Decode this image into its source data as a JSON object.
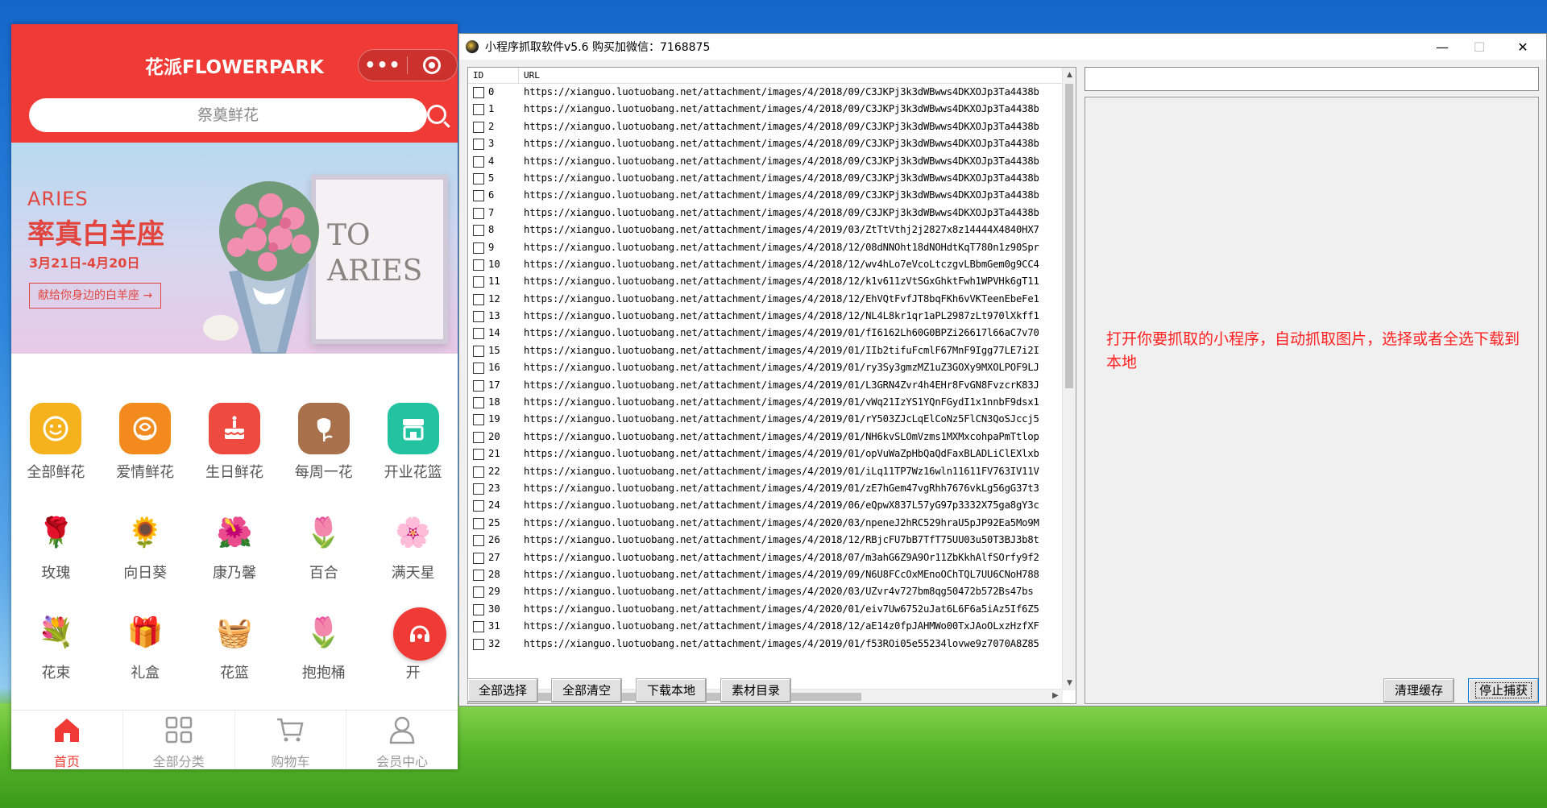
{
  "phone": {
    "title": "花派FLOWERPARK",
    "capsule_more": "•••",
    "search_placeholder": "祭奠鲜花",
    "banner": {
      "aries_en": "ARIES",
      "title": "率真白羊座",
      "date": "3月21日-4月20日",
      "button": "献给你身边的白羊座 →",
      "frame_text_1": "TO",
      "frame_text_2": "ARIES"
    },
    "categories_main": [
      {
        "label": "全部鲜花",
        "icon": "smile-flower-icon",
        "color": "#f6b21c"
      },
      {
        "label": "爱情鲜花",
        "icon": "rose-icon",
        "color": "#f28a1e"
      },
      {
        "label": "生日鲜花",
        "icon": "cake-icon",
        "color": "#ef4a3f"
      },
      {
        "label": "每周一花",
        "icon": "flower-bud-icon",
        "color": "#a8714c"
      },
      {
        "label": "开业花篮",
        "icon": "shop-icon",
        "color": "#23c2a0"
      }
    ],
    "categories_flowers": [
      {
        "label": "玫瑰",
        "glyph": "🌹"
      },
      {
        "label": "向日葵",
        "glyph": "🌻"
      },
      {
        "label": "康乃馨",
        "glyph": "🌺"
      },
      {
        "label": "百合",
        "glyph": "🌷"
      },
      {
        "label": "满天星",
        "glyph": "🌸"
      }
    ],
    "categories_gifts": [
      {
        "label": "花束",
        "glyph": "💐"
      },
      {
        "label": "礼盒",
        "glyph": "🎁"
      },
      {
        "label": "花篮",
        "glyph": "🧺"
      },
      {
        "label": "抱抱桶",
        "glyph": "🌷"
      },
      {
        "label": "开",
        "glyph": "🌱"
      }
    ],
    "tabs": [
      {
        "label": "首页",
        "icon": "home-icon",
        "active": true
      },
      {
        "label": "全部分类",
        "icon": "grid-icon",
        "active": false
      },
      {
        "label": "购物车",
        "icon": "cart-icon",
        "active": false
      },
      {
        "label": "会员中心",
        "icon": "user-icon",
        "active": false
      }
    ],
    "accent": "#f03a35"
  },
  "window": {
    "title": "小程序抓取软件v5.6 购买加微信：7168875",
    "min": "—",
    "max": "☐",
    "close": "✕",
    "columns": {
      "id": "ID",
      "url": "URL"
    },
    "rows": [
      {
        "id": "0",
        "url": "https://xianguo.luotuobang.net/attachment/images/4/2018/09/C3JKPj3k3dWBwws4DKXOJp3Ta4438b"
      },
      {
        "id": "1",
        "url": "https://xianguo.luotuobang.net/attachment/images/4/2018/09/C3JKPj3k3dWBwws4DKXOJp3Ta4438b"
      },
      {
        "id": "2",
        "url": "https://xianguo.luotuobang.net/attachment/images/4/2018/09/C3JKPj3k3dWBwws4DKXOJp3Ta4438b"
      },
      {
        "id": "3",
        "url": "https://xianguo.luotuobang.net/attachment/images/4/2018/09/C3JKPj3k3dWBwws4DKXOJp3Ta4438b"
      },
      {
        "id": "4",
        "url": "https://xianguo.luotuobang.net/attachment/images/4/2018/09/C3JKPj3k3dWBwws4DKXOJp3Ta4438b"
      },
      {
        "id": "5",
        "url": "https://xianguo.luotuobang.net/attachment/images/4/2018/09/C3JKPj3k3dWBwws4DKXOJp3Ta4438b"
      },
      {
        "id": "6",
        "url": "https://xianguo.luotuobang.net/attachment/images/4/2018/09/C3JKPj3k3dWBwws4DKXOJp3Ta4438b"
      },
      {
        "id": "7",
        "url": "https://xianguo.luotuobang.net/attachment/images/4/2018/09/C3JKPj3k3dWBwws4DKXOJp3Ta4438b"
      },
      {
        "id": "8",
        "url": "https://xianguo.luotuobang.net/attachment/images/4/2019/03/ZtTtVthj2j2827x8z14444X4840HX7"
      },
      {
        "id": "9",
        "url": "https://xianguo.luotuobang.net/attachment/images/4/2018/12/08dNNOht18dNOHdtKqT780n1z90Spr"
      },
      {
        "id": "10",
        "url": "https://xianguo.luotuobang.net/attachment/images/4/2018/12/wv4hLo7eVcoLtczgvLBbmGem0g9CC4"
      },
      {
        "id": "11",
        "url": "https://xianguo.luotuobang.net/attachment/images/4/2018/12/k1v611zVtSGxGhktFwh1WPVHk6gT11"
      },
      {
        "id": "12",
        "url": "https://xianguo.luotuobang.net/attachment/images/4/2018/12/EhVQtFvfJT8bqFKh6vVKTeenEbeFe1"
      },
      {
        "id": "13",
        "url": "https://xianguo.luotuobang.net/attachment/images/4/2018/12/NL4L8kr1qr1aPL2987zLt970lXkff1"
      },
      {
        "id": "14",
        "url": "https://xianguo.luotuobang.net/attachment/images/4/2019/01/fI6162Lh60G0BPZi26617l66aC7v70"
      },
      {
        "id": "15",
        "url": "https://xianguo.luotuobang.net/attachment/images/4/2019/01/IIb2tifuFcmlF67MnF9Igg77LE7i2I"
      },
      {
        "id": "16",
        "url": "https://xianguo.luotuobang.net/attachment/images/4/2019/01/ry3Sy3gmzMZ1uZ3GOXy9MXOLPOF9LJ"
      },
      {
        "id": "17",
        "url": "https://xianguo.luotuobang.net/attachment/images/4/2019/01/L3GRN4Zvr4h4EHr8FvGN8FvzcrK83J"
      },
      {
        "id": "18",
        "url": "https://xianguo.luotuobang.net/attachment/images/4/2019/01/vWq21IzYS1YQnFGydI1x1nnbF9dsx1"
      },
      {
        "id": "19",
        "url": "https://xianguo.luotuobang.net/attachment/images/4/2019/01/rY503ZJcLqElCoNz5FlCN3QoSJccj5"
      },
      {
        "id": "20",
        "url": "https://xianguo.luotuobang.net/attachment/images/4/2019/01/NH6kvSLOmVzms1MXMxcohpaPmTtlop"
      },
      {
        "id": "21",
        "url": "https://xianguo.luotuobang.net/attachment/images/4/2019/01/opVuWaZpHbQaQdFaxBLADLiClEXlxb"
      },
      {
        "id": "22",
        "url": "https://xianguo.luotuobang.net/attachment/images/4/2019/01/iLq11TP7Wz16wln11611FV763IV11V"
      },
      {
        "id": "23",
        "url": "https://xianguo.luotuobang.net/attachment/images/4/2019/01/zE7hGem47vgRhh7676vkLg56gG37t3"
      },
      {
        "id": "24",
        "url": "https://xianguo.luotuobang.net/attachment/images/4/2019/06/eQpwX837L57yG97p3332X75ga8gY3c"
      },
      {
        "id": "25",
        "url": "https://xianguo.luotuobang.net/attachment/images/4/2020/03/npeneJ2hRC529hraU5pJP92Ea5Mo9M"
      },
      {
        "id": "26",
        "url": "https://xianguo.luotuobang.net/attachment/images/4/2018/12/RBjcFU7bB7TfT75UU03u50T3BJ3b8t"
      },
      {
        "id": "27",
        "url": "https://xianguo.luotuobang.net/attachment/images/4/2018/07/m3ahG6Z9A9Or11ZbKkhAlfSOrfy9f2"
      },
      {
        "id": "28",
        "url": "https://xianguo.luotuobang.net/attachment/images/4/2019/09/N6U8FCcOxMEnoOChTQL7UU6CNoH788"
      },
      {
        "id": "29",
        "url": "https://xianguo.luotuobang.net/attachment/images/4/2020/03/UZvr4v727bm8qg50472b572Bs47bs"
      },
      {
        "id": "30",
        "url": "https://xianguo.luotuobang.net/attachment/images/4/2020/01/eiv7Uw6752uJat6L6F6a5iAz5If6Z5"
      },
      {
        "id": "31",
        "url": "https://xianguo.luotuobang.net/attachment/images/4/2018/12/aE14z0fpJAHMWo00TxJAoOLxzHzfXF"
      },
      {
        "id": "32",
        "url": "https://xianguo.luotuobang.net/attachment/images/4/2019/01/f53ROi05e55234lovwe9z7070A8Z85"
      }
    ],
    "url_input_value": "",
    "hint": "打开你要抓取的小程序，自动抓取图片，选择或者全选下载到本地",
    "buttons": {
      "select_all": "全部选择",
      "clear_all": "全部清空",
      "download": "下载本地",
      "material_dir": "素材目录",
      "clear_cache": "清理缓存",
      "stop_capture": "停止捕获"
    },
    "hint_color": "#ff2020"
  }
}
